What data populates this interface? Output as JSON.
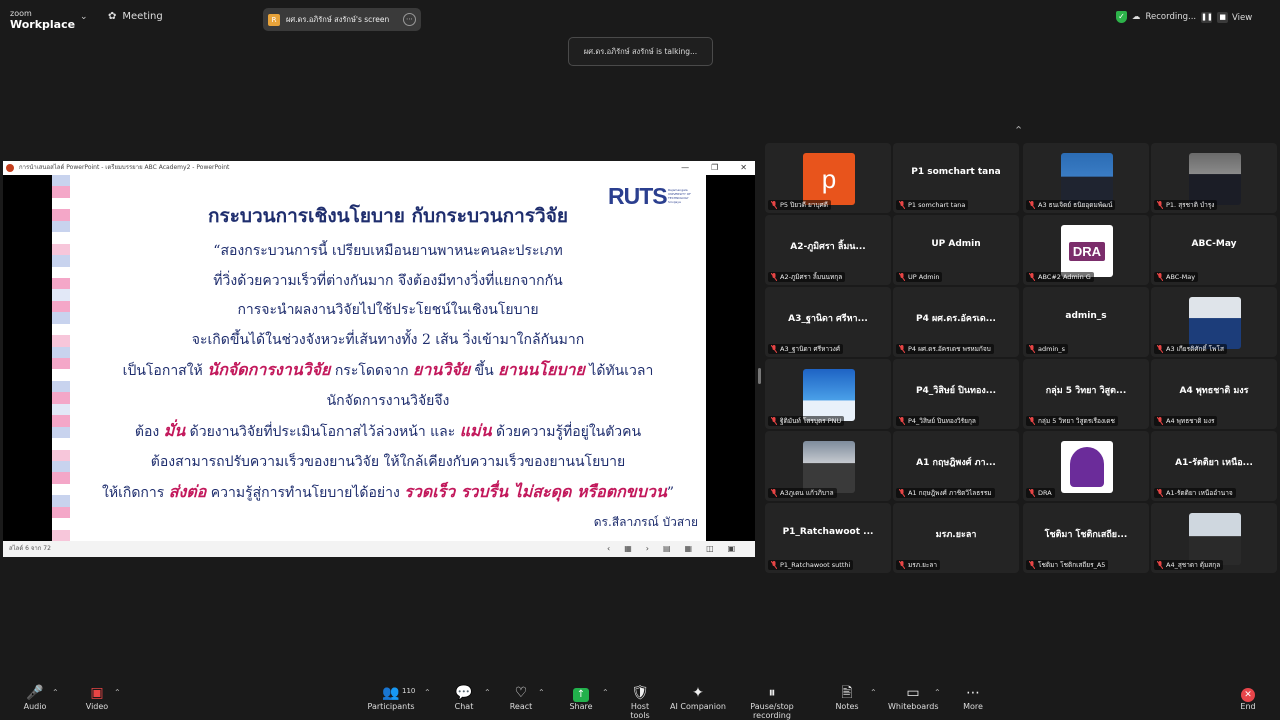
{
  "app": {
    "logo_line1": "zoom",
    "logo_line2": "Workplace",
    "meeting_label": "Meeting",
    "share_pill_text": "ผศ.ดร.อภิรักษ์ สงรักษ์'s screen",
    "recording_label": "Recording...",
    "view_label": "View",
    "talking_text": "ผศ.ดร.อภิรักษ์ สงรักษ์ is talking..."
  },
  "ppt": {
    "title_text": "การนำเสนอสไลด์ PowerPoint  -  เตรียมบรรยาย ABC Academy2 - PowerPoint",
    "status_text": "สไลด์ 6 จาก 72",
    "brand": "RUTS",
    "brand_sub": "Rajamangala UNIVERSITY OF TECHNOLOGY Srivijaya",
    "slide_title": "กระบวนการเชิงนโยบาย กับกระบวนการวิจัย",
    "line1": "“สองกระบวนการนี้ เปรียบเหมือนยานพาหนะคนละประเภท",
    "line2": "ที่วิ่งด้วยความเร็วที่ต่างกันมาก จึงต้องมีทางวิ่งที่แยกจากกัน",
    "line3": "การจะนำผลงานวิจัยไปใช้ประโยชน์ในเชิงนโยบาย",
    "line4": "จะเกิดขึ้นได้ในช่วงจังหวะที่เส้นทางทั้ง 2 เส้น วิ่งเข้ามาใกล้กันมาก",
    "line5a": "เป็นโอกาสให้ ",
    "line5b": "นักจัดการงานวิจัย",
    "line5c": " กระโดดจาก ",
    "line5d": "ยานวิจัย",
    "line5e": " ขึ้น ",
    "line5f": "ยานนโยบาย",
    "line5g": " ได้ทันเวลา",
    "line6": "นักจัดการงานวิจัยจึง",
    "line7a": "ต้อง ",
    "line7b": "มั่น",
    "line7c": " ด้วยงานวิจัยที่ประเมินโอกาสไว้ล่วงหน้า และ ",
    "line7d": "แม่น",
    "line7e": " ด้วยความรู้ที่อยู่ในตัวคน",
    "line8": "ต้องสามารถปรับความเร็วของยานวิจัย ให้ใกล้เคียงกับความเร็วของยานนโยบาย",
    "line9a": "ให้เกิดการ ",
    "line9b": "ส่งต่อ",
    "line9c": " ความรู้สู่การทำนโยบายได้อย่าง ",
    "line9d": "รวดเร็ว รวบรื่น ไม่สะดุด หรือตกขบวน",
    "line9e": "”",
    "author": "ดร.สีลาภรณ์ บัวสาย"
  },
  "gallery": [
    {
      "name": "",
      "label": "P5 ปิยวดี ยาบุศดี",
      "pic": "p"
    },
    {
      "name": "P1 somchart tana",
      "label": "P1 somchart tana",
      "pic": ""
    },
    {
      "name": "",
      "label": "A3 ธนเจิดย์ ธนิยอุดมพัฒน์",
      "pic": "face1"
    },
    {
      "name": "",
      "label": "P1. สุรชาติ บำรุง",
      "pic": "face2"
    },
    {
      "name": "A2-ภูมิศรา ลิ้มน...",
      "label": "A2-ภูมิศรา ลิ้มนนทกุล",
      "pic": ""
    },
    {
      "name": "UP Admin",
      "label": "UP Admin",
      "pic": ""
    },
    {
      "name": "",
      "label": "ABC#2 Admin G",
      "pic": "dra"
    },
    {
      "name": "ABC-May",
      "label": "ABC-May",
      "pic": ""
    },
    {
      "name": "A3_ฐานิดา ศรีหา...",
      "label": "A3_ฐานิดา ศรีหาวงศ์",
      "pic": ""
    },
    {
      "name": "P4 ผศ.ดร.อัครเด...",
      "label": "P4 ผศ.ดร.อัครเดช พรหมกัจบ",
      "pic": ""
    },
    {
      "name": "admin_s",
      "label": "admin_s",
      "pic": ""
    },
    {
      "name": "",
      "label": "A3 เกียรติศักดิ์ โพโส",
      "pic": "face3"
    },
    {
      "name": "",
      "label": "ฐิติมันท์ โสรบุตร PNU",
      "pic": "poster"
    },
    {
      "name": "P4_วิสิษย์ ปินทอง...",
      "label": "P4_วิสิษย์ ปินทองวิรัยกุล",
      "pic": ""
    },
    {
      "name": "กลุ่ม 5 วิทยา วิสูต...",
      "label": "กลุ่ม 5 วิทยา วิสูตรเรืองเดช",
      "pic": ""
    },
    {
      "name": "A4 พุทธชาติ มงร",
      "label": "A4 พุทธชาติ มงร",
      "pic": ""
    },
    {
      "name": "",
      "label": "A3ภูเดน แก้วภิบาล",
      "pic": "face4"
    },
    {
      "name": "A1 กฤษฎิพงศ์ ภา...",
      "label": "A1 กฤษฎิพงศ์ ภาชิตวิไลธรรม",
      "pic": ""
    },
    {
      "name": "",
      "label": "DRA",
      "pic": "seal"
    },
    {
      "name": "A1-รัตติยา เหนือ...",
      "label": "A1-รัตติยา เหนืออำนาจ",
      "pic": ""
    },
    {
      "name": "P1_Ratchawoot ...",
      "label": "P1_Ratchawoot sutthi",
      "pic": ""
    },
    {
      "name": "มรภ.ยะลา",
      "label": "มรภ.ยะลา",
      "pic": ""
    },
    {
      "name": "โชติมา โชติกเสถีย...",
      "label": "โชติมา โชติกเสถียร_A5",
      "pic": ""
    },
    {
      "name": "",
      "label": "A4_สุชาดา ตุ้มสกุล",
      "pic": "face5"
    }
  ],
  "toolbar": {
    "audio": "Audio",
    "video": "Video",
    "participants": "Participants",
    "participants_count": "110",
    "chat": "Chat",
    "react": "React",
    "share": "Share",
    "host_tools": "Host tools",
    "ai_companion": "AI Companion",
    "pause_recording": "Pause/stop recording",
    "notes": "Notes",
    "whiteboards": "Whiteboards",
    "more": "More",
    "end": "End"
  },
  "colors": {
    "background": "#1a1a1a",
    "tile": "#242424",
    "slide_text": "#1f2e6e",
    "highlight": "#c2185b",
    "share_green": "#22b14c",
    "end_red": "#e8454a"
  }
}
